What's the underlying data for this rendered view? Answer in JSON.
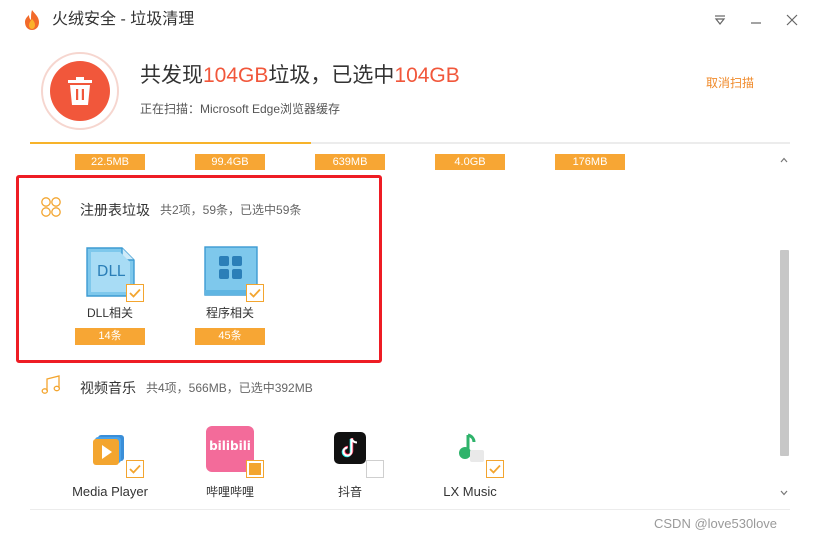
{
  "window": {
    "title": "火绒安全 - 垃圾清理",
    "colors": {
      "accent": "#f1573b",
      "orange": "#f7a634",
      "link": "#f08a2a",
      "highlight": "#ee1c24"
    }
  },
  "header": {
    "summary_prefix": "共发现",
    "summary_found": "104GB",
    "summary_mid": "垃圾，已选中",
    "summary_selected": "104GB",
    "scan_status": "正在扫描：Microsoft Edge浏览器缓存",
    "cancel_label": "取消扫描",
    "progress_fraction": 0.37
  },
  "top_badges": [
    "22.5MB",
    "99.4GB",
    "639MB",
    "4.0GB",
    "176MB"
  ],
  "sections": [
    {
      "title": "注册表垃圾",
      "info": "共2项，59条，已选中59条",
      "icon": "registry-icon",
      "items": [
        {
          "label": "DLL相关",
          "badge": "14条",
          "icon": "dll-file-icon",
          "icon_text": "DLL",
          "check": "checked"
        },
        {
          "label": "程序相关",
          "badge": "45条",
          "icon": "program-grid-icon",
          "check": "checked"
        }
      ]
    },
    {
      "title": "视频音乐",
      "info": "共4项，566MB，已选中392MB",
      "icon": "music-note-icon",
      "items": [
        {
          "label": "Media Player",
          "icon": "media-player-icon",
          "check": "checked"
        },
        {
          "label": "哔哩哔哩",
          "icon": "bilibili-icon",
          "icon_text": "bilibili",
          "check": "partial"
        },
        {
          "label": "抖音",
          "icon": "douyin-icon",
          "check": "unchecked"
        },
        {
          "label": "LX Music",
          "icon": "lx-music-icon",
          "check": "checked"
        }
      ]
    }
  ],
  "watermark": "CSDN @love530love"
}
